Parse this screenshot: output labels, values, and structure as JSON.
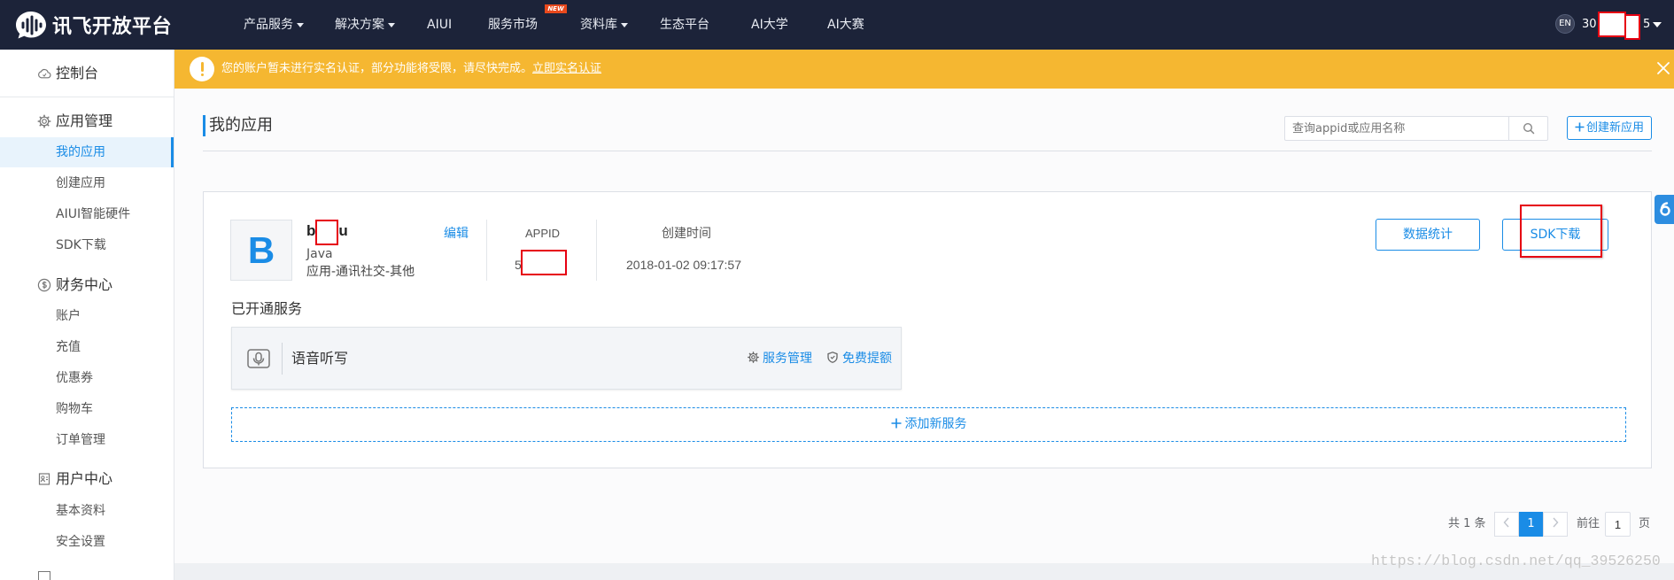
{
  "colors": {
    "header_bg": "#1c2339",
    "accent": "#1a8ce6",
    "banner_bg": "#f5b731",
    "new_badge": "#e8491d",
    "annotation_red": "#e60012"
  },
  "header": {
    "logo_text": "讯飞开放平台",
    "logo_icon": "iflytek-logo-icon",
    "nav": [
      {
        "label": "产品服务",
        "has_dropdown": true
      },
      {
        "label": "解决方案",
        "has_dropdown": true
      },
      {
        "label": "AIUI",
        "has_dropdown": false
      },
      {
        "label": "服务市场",
        "has_dropdown": false,
        "badge": "NEW"
      },
      {
        "label": "资料库",
        "has_dropdown": true
      },
      {
        "label": "生态平台",
        "has_dropdown": false
      },
      {
        "label": "AI大学",
        "has_dropdown": false
      },
      {
        "label": "AI大赛",
        "has_dropdown": false
      }
    ],
    "language": "EN",
    "user_name_visible_start": "30",
    "user_name_visible_end": "5"
  },
  "sidebar": {
    "dashboard": {
      "label": "控制台",
      "icon": "cloud-icon"
    },
    "groups": [
      {
        "label": "应用管理",
        "icon": "gear-icon",
        "items": [
          "我的应用",
          "创建应用",
          "AIUI智能硬件",
          "SDK下载"
        ],
        "active_index": 0
      },
      {
        "label": "财务中心",
        "icon": "coin-icon",
        "items": [
          "账户",
          "充值",
          "优惠券",
          "购物车",
          "订单管理"
        ]
      },
      {
        "label": "用户中心",
        "icon": "user-card-icon",
        "items": [
          "基本资料",
          "安全设置"
        ]
      }
    ]
  },
  "banner": {
    "icon": "exclamation-icon",
    "message": "您的账户暂未进行实名认证，部分功能将受限，请尽快完成。",
    "link_label": "立即实名认证",
    "close_icon": "close-icon"
  },
  "page": {
    "title": "我的应用",
    "search_placeholder": "查询appid或应用名称",
    "search_icon": "search-icon",
    "create_button": "创建新应用"
  },
  "app": {
    "icon_letter": "B",
    "name_visible_start": "b",
    "name_visible_end": "u",
    "platform": "Java",
    "category": "应用-通讯社交-其他",
    "edit_label": "编辑",
    "appid_label": "APPID",
    "appid_visible_start": "5",
    "created_label": "创建时间",
    "created_value": "2018-01-02 09:17:57",
    "stats_button": "数据统计",
    "sdk_button": "SDK下载",
    "services_title": "已开通服务",
    "services": [
      {
        "name": "语音听写",
        "icon": "microphone-icon",
        "manage_label": "服务管理",
        "quota_label": "免费提额"
      }
    ],
    "add_service_label": "添加新服务"
  },
  "pagination": {
    "total_text": "共 1 条",
    "current_page": "1",
    "goto_label": "前往",
    "goto_value": "1",
    "page_suffix": "页"
  },
  "watermark": "https://blog.csdn.net/qq_39526250"
}
